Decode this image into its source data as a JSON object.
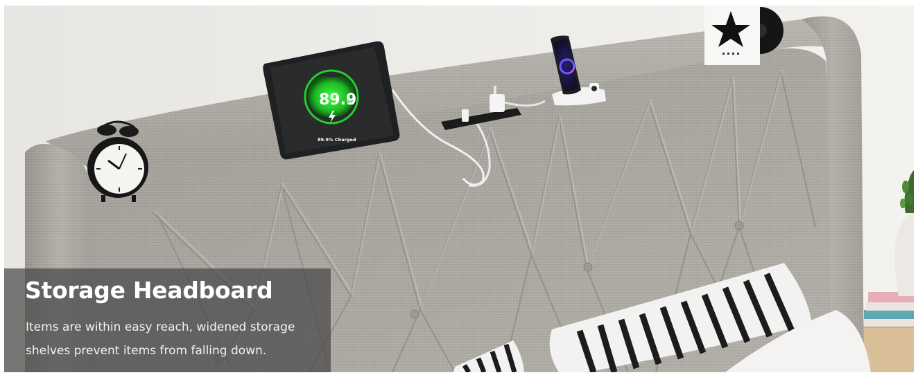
{
  "caption": {
    "title": "Storage Headboard",
    "text": "Items are within easy reach, widened storage shelves prevent items from falling down."
  },
  "tablet": {
    "charge_percent": "89.9",
    "percent_sign": "%",
    "status": "89.9% Charged"
  },
  "colors": {
    "fabric": "#a7a39e",
    "fabric_light": "#c2beb8",
    "wall": "#ecebe9",
    "charge_green": "#22c62c",
    "caption_panel": "#464646"
  },
  "icons": {
    "clock": "alarm-clock-icon",
    "charge": "lightning-bolt-icon",
    "vinyl": "star-icon"
  }
}
